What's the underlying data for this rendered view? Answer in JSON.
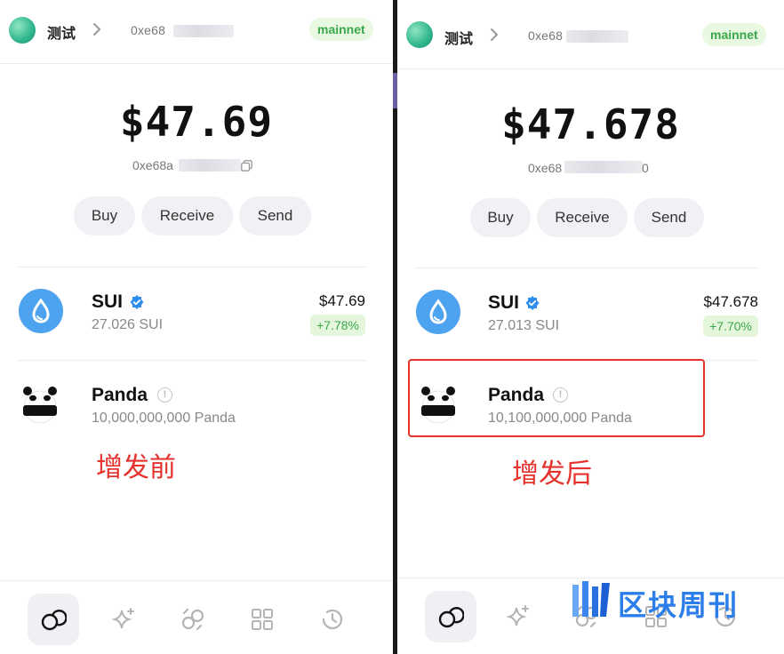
{
  "left": {
    "account_name": "测试",
    "address_short": "0xe68",
    "network": "mainnet",
    "balance": "$47.69",
    "address_line": "0xe68a",
    "buttons": [
      "Buy",
      "Receive",
      "Send"
    ],
    "coins": [
      {
        "name": "SUI",
        "amount": "27.026 SUI",
        "usd": "$47.69",
        "change": "+7.78%",
        "verified": true,
        "icon": "sui-icon"
      },
      {
        "name": "Panda",
        "amount": "10,000,000,000 Panda",
        "icon": "panda-icon"
      }
    ],
    "annotation": "增发前"
  },
  "right": {
    "account_name": "测试",
    "address_short": "0xe68",
    "network": "mainnet",
    "balance": "$47.678",
    "address_line": "0xe68",
    "address_tail": "0",
    "buttons": [
      "Buy",
      "Receive",
      "Send"
    ],
    "coins": [
      {
        "name": "SUI",
        "amount": "27.013 SUI",
        "usd": "$47.678",
        "change": "+7.70%",
        "verified": true,
        "icon": "sui-icon"
      },
      {
        "name": "Panda",
        "amount": "10,100,000,000 Panda",
        "icon": "panda-icon"
      }
    ],
    "annotation": "增发后"
  },
  "nav": [
    "tokens-icon",
    "sparkles-icon",
    "swap-icon",
    "apps-icon",
    "history-icon"
  ],
  "watermark": "区块周刊",
  "colors": {
    "accent_green": "#3aa74a",
    "annotation_red": "#e5322d",
    "sui_blue": "#4da3f0"
  }
}
